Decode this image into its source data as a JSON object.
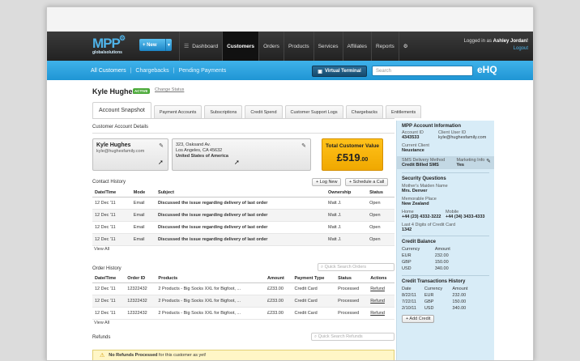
{
  "nav": {
    "logo": "MPP",
    "logo_sub": "globalsolutions",
    "new_button": "New",
    "items": [
      "Dashboard",
      "Customers",
      "Orders",
      "Products",
      "Services",
      "Affiliates",
      "Reports"
    ],
    "active_item": "Customers",
    "login_prefix": "Logged in as",
    "login_user": "Ashley Jordan!",
    "logout": "Logout"
  },
  "subnav": {
    "links": [
      "All Customers",
      "Chargebacks",
      "Pending Payments"
    ],
    "virtual_terminal": "Virtual Terminal",
    "search_placeholder": "Search",
    "brand": "eHQ"
  },
  "customer": {
    "name": "Kyle Hughes",
    "badge": "ACTIVE",
    "change_status": "Change Status"
  },
  "tabs": [
    "Account Snapshot",
    "Payment Accounts",
    "Subscriptions",
    "Credit Spend",
    "Customer Support Logs",
    "Chargebacks",
    "Entitlements"
  ],
  "details": {
    "title": "Customer Account Details",
    "contact_name": "Kyle Hughes",
    "contact_email": "kyle@hughesfamily.com",
    "address1": "323, Oaksand Av.",
    "address2": "Los Angeles, CA 45632",
    "country": "United States of America",
    "tcv_label": "Total Customer Value",
    "tcv_value": "£519",
    "tcv_pence": ".00"
  },
  "contact_history": {
    "title": "Contact History",
    "log_new": "+ Log New",
    "schedule": "+ Schedule a Call",
    "columns": [
      "Date/Time",
      "Mode",
      "Subject",
      "Ownership",
      "Status"
    ],
    "rows": [
      [
        "12 Dec '11",
        "Email",
        "Discussed the issue regarding delivery of last order",
        "Matt J.",
        "Open"
      ],
      [
        "12 Dec '11",
        "Email",
        "Discussed the issue regarding delivery of last order",
        "Matt J.",
        "Open"
      ],
      [
        "12 Dec '11",
        "Email",
        "Discussed the issue regarding delivery of last order",
        "Matt J.",
        "Open"
      ],
      [
        "12 Dec '11",
        "Email",
        "Discussed the issue regarding delivery of last order",
        "Matt J.",
        "Open"
      ]
    ],
    "view_all": "View All"
  },
  "order_history": {
    "title": "Order History",
    "search_placeholder": "Quick Search Orders",
    "columns": [
      "Date/Time",
      "Order ID",
      "Products",
      "Amount",
      "Payment Type",
      "Status",
      "Actions"
    ],
    "rows": [
      [
        "12 Dec '11",
        "12322432",
        "2 Products - Big Socks XXL for Bigfoot, ...",
        "£233.00",
        "Credit Card",
        "Processed",
        "Refund"
      ],
      [
        "12 Dec '11",
        "12322432",
        "2 Products - Big Socks XXL for Bigfoot, ...",
        "£233.00",
        "Credit Card",
        "Processed",
        "Refund"
      ],
      [
        "12 Dec '11",
        "12322432",
        "2 Products - Big Socks XXL for Bigfoot, ...",
        "£233.00",
        "Credit Card",
        "Processed",
        "Refund"
      ]
    ],
    "view_all": "View All"
  },
  "refunds": {
    "title": "Refunds",
    "search_placeholder": "Quick Search Refunds",
    "notice_bold": "No Refunds Processed",
    "notice_rest": "for this customer as yet!"
  },
  "sidebar": {
    "title": "MPP Account Information",
    "account_id_label": "Account ID",
    "account_id": "4343533",
    "client_user_id_label": "Client User ID",
    "client_user_id": "kyle@hughesfamily.com",
    "current_client_label": "Current Client",
    "current_client": "Neustance",
    "sms_label": "SMS Delivery Method",
    "sms_value": "Credit Billed SMS",
    "marketing_label": "Marketing Info",
    "marketing_value": "Yes",
    "security_title": "Security Questions",
    "maiden_label": "Mother's Maiden Name",
    "maiden_value": "Mrs. Denver",
    "place_label": "Memorable Place",
    "place_value": "New Zealand",
    "home_label": "Home",
    "home_value": "+44 (23) 4332-3222",
    "mobile_label": "Mobile",
    "mobile_value": "+44 (34) 3433-4333",
    "card_label": "Last 4 Digits of Credit Card",
    "card_value": "1342",
    "balance_title": "Credit Balance",
    "balance_cols": [
      "Currency",
      "Amount"
    ],
    "balance_rows": [
      [
        "EUR",
        "232.00"
      ],
      [
        "GBP",
        "150.00"
      ],
      [
        "USD",
        "340.00"
      ]
    ],
    "trans_title": "Credit Transactions History",
    "trans_cols": [
      "Date",
      "Currency",
      "Amount"
    ],
    "trans_rows": [
      [
        "8/22/11",
        "EUR",
        "232.00"
      ],
      [
        "7/22/11",
        "GBP",
        "150.00"
      ],
      [
        "2/10/11",
        "USD",
        "340.00"
      ]
    ],
    "add_credit": "+ Add Credit"
  }
}
